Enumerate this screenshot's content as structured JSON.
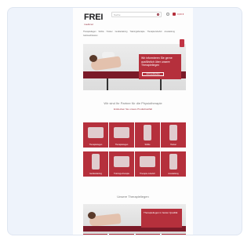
{
  "header": {
    "logo_main": "FREI",
    "logo_sub": "medical",
    "search_placeholder": "Suche",
    "cart_label": "0,00 €"
  },
  "nav": {
    "items": [
      "Therapieliegen",
      "Stühle",
      "Hocker",
      "Gerätetraining",
      "Trainingstherapie",
      "Therapiezubehör",
      "Ausstattung",
      "Gebrauchtwaren"
    ]
  },
  "hero": {
    "text": "Wir informieren Sie gerne ausführlich über unsere Therapieliegen",
    "button": "Jetzt entdecken"
  },
  "section": {
    "title": "Wir sind Ihr Partner für die Physiotherapie",
    "subtitle": "Entdecken Sie unsere Produktvielfalt"
  },
  "tiles": [
    {
      "label": "Therapieliegen"
    },
    {
      "label": "Therapieliegen"
    },
    {
      "label": "Stühle"
    },
    {
      "label": "Hocker"
    },
    {
      "label": "Gerätetraining"
    },
    {
      "label": "Trainings-therapie"
    },
    {
      "label": "Therapie-zubehör"
    },
    {
      "label": "Ausstattung"
    }
  ],
  "section2": {
    "title": "Unsere Therapieliegen"
  },
  "hero2": {
    "text": "Therapieliegen in bester Qualität"
  },
  "colors": {
    "accent": "#b5303c",
    "card_bg": "#eef3fb"
  }
}
